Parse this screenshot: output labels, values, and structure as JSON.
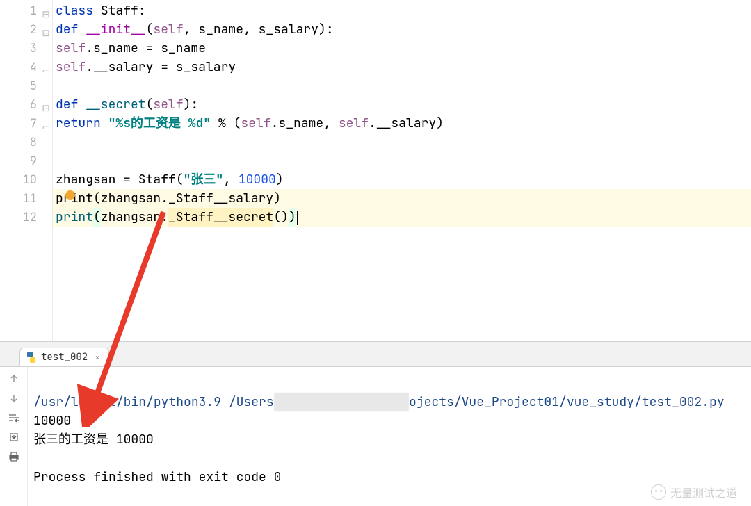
{
  "lines": [
    "1",
    "2",
    "3",
    "4",
    "5",
    "6",
    "7",
    "8",
    "9",
    "10",
    "11",
    "12"
  ],
  "code": {
    "l1": {
      "kw": "class ",
      "cls": "Staff",
      "colon": ":"
    },
    "l2": {
      "kw": "def ",
      "fn": "__init__",
      "sig": "(",
      "self": "self",
      "rest": ", s_name, s_salary):"
    },
    "l3": {
      "self": "self",
      "attr": ".s_name = s_name"
    },
    "l4": {
      "self": "self",
      "attr": ".__salary = s_salary"
    },
    "l6": {
      "kw": "def ",
      "fn": "__secret",
      "sig": "(",
      "self": "self",
      "rest": "):"
    },
    "l7": {
      "kw": "return ",
      "str": "\"%s的工资是 %d\"",
      "op": " % (",
      "self1": "self",
      "mid": ".s_name, ",
      "self2": "self",
      "end": ".__salary)"
    },
    "l10": {
      "var": "zhangsan = Staff(",
      "str": "\"张三\"",
      "comma": ", ",
      "num": "10000",
      "close": ")"
    },
    "l11": {
      "pr": "p",
      "r": "r",
      "int": "int(zhangsan._Staff__salary)"
    },
    "l12": {
      "print": "print",
      "op1": "(",
      "arg": "zhangsan.",
      "hl": "_Staff__secret",
      "op2": "()",
      ")": ")"
    }
  },
  "tab": {
    "name": "test_002",
    "close": "×"
  },
  "console": {
    "path_pre": "/usr/lo",
    "path_mid": "al/bin/python3.9 /Users",
    "path_hidden": "█████  ████ ███ ██",
    "path_post": "ojects/Vue_Project01/vue_study/test_002.py",
    "out1": "10000",
    "out2": "张三的工资是 10000",
    "exit": "Process finished with exit code 0"
  },
  "watermark": "无量测试之道"
}
